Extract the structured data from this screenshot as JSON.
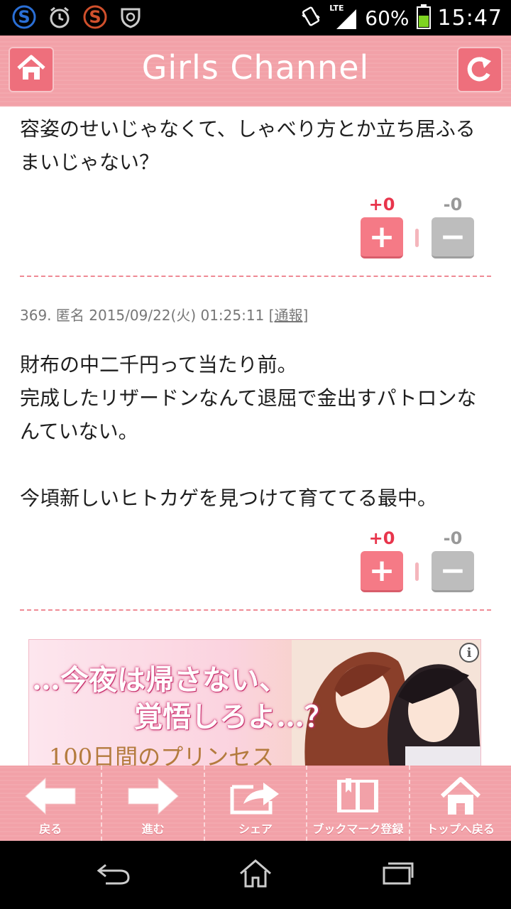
{
  "status_bar": {
    "network": "LTE",
    "battery_percent": "60%",
    "time": "15:47",
    "icons": [
      "s-app-icon",
      "alarm-clock-icon",
      "s-app-icon",
      "shield-icon",
      "vibrate-icon",
      "signal-icon",
      "battery-icon"
    ]
  },
  "header": {
    "title": "Girls Channel",
    "left_icon": "home-icon",
    "right_icon": "reload-icon",
    "accent": "#f2a1a8"
  },
  "comments": [
    {
      "text": "容姿のせいじゃなくて、しゃべり方とか立ち居ふるまいじゃない？",
      "plus": "+0",
      "minus": "-0"
    },
    {
      "meta": "369. 匿名 2015/09/22(火) 01:25:11",
      "report": "通報",
      "text": "財布の中二千円って当たり前。\n完成したリザードンなんて退屈で金出すパトロンなんていない。\n\n今頃新しいヒトカゲを見つけて育ててる最中。",
      "plus": "+0",
      "minus": "-0"
    }
  ],
  "vote_labels": {
    "plus_symbol": "+",
    "minus_symbol": "−"
  },
  "ad": {
    "headline_1": "…今夜は帰さない、",
    "headline_2": "覚悟しろよ…？",
    "product": "100日間のプリンセス",
    "info": "i"
  },
  "toolbar": {
    "items": [
      {
        "label": "戻る",
        "icon": "arrow-left-icon"
      },
      {
        "label": "進む",
        "icon": "arrow-right-icon"
      },
      {
        "label": "シェア",
        "icon": "share-icon"
      },
      {
        "label": "ブックマーク登録",
        "icon": "bookmark-book-icon"
      },
      {
        "label": "トップへ戻る",
        "icon": "home-icon"
      }
    ]
  },
  "nav_bar": {
    "icons": [
      "back-icon",
      "home-icon",
      "recent-apps-icon"
    ]
  },
  "colors": {
    "plus_count": "#e8354c",
    "minus_count": "#999999",
    "plus_button": "#f57a86",
    "minus_button": "#bdbdbd"
  }
}
